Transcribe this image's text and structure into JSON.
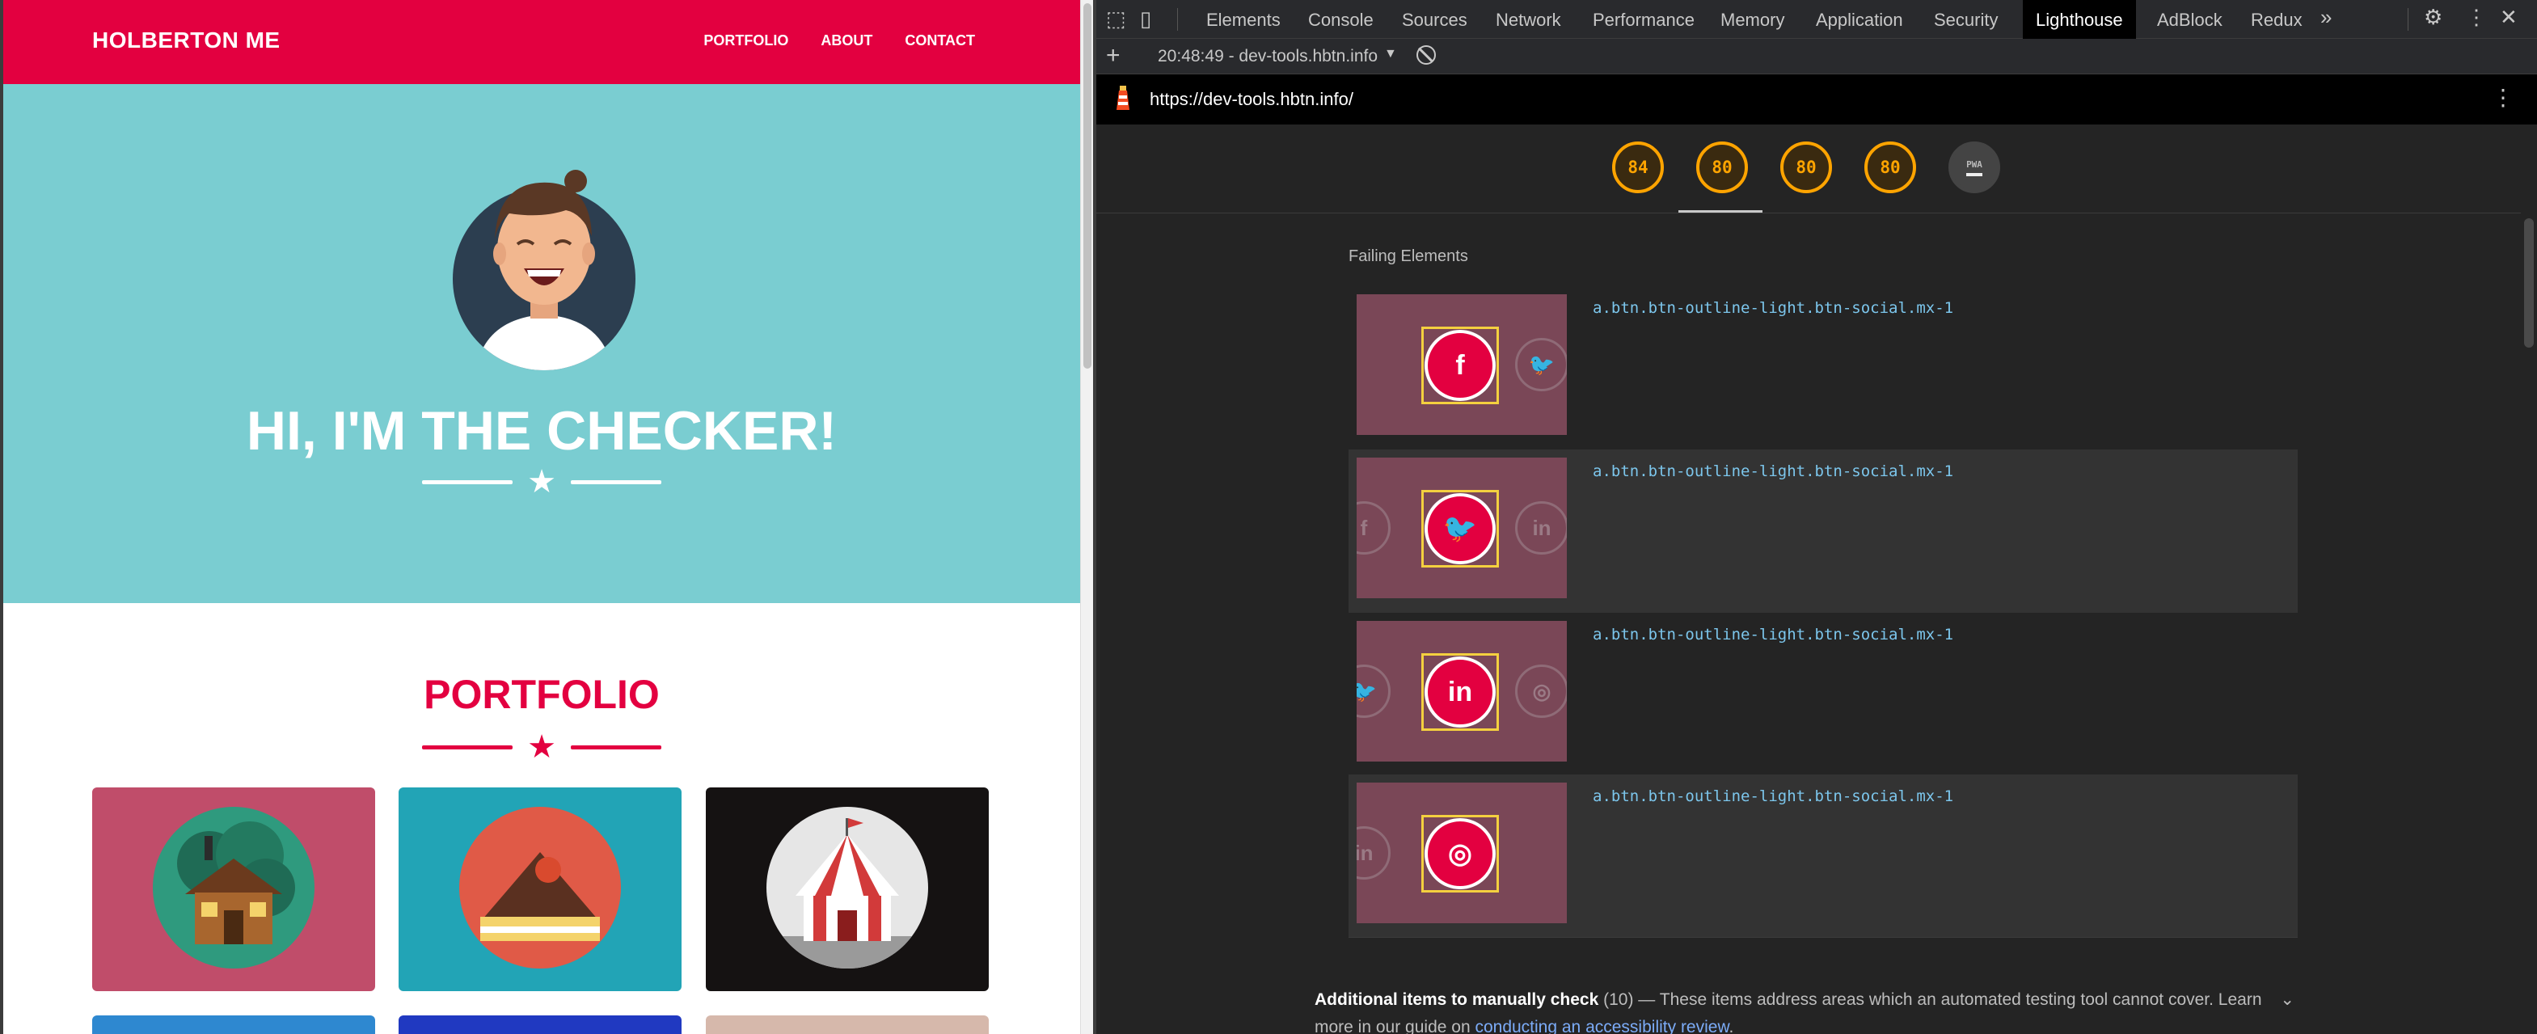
{
  "site": {
    "brand": "HOLBERTON ME",
    "nav": [
      "PORTFOLIO",
      "ABOUT",
      "CONTACT"
    ],
    "hero_title": "HI, I'M THE CHECKER!",
    "portfolio_title": "PORTFOLIO",
    "colors": {
      "primary": "#e30040",
      "hero_bg": "#7acdd1"
    },
    "cards": [
      {
        "icon": "cabin-icon",
        "bg": "#c04d6a"
      },
      {
        "icon": "cake-icon",
        "bg": "#22a4b6"
      },
      {
        "icon": "circus-tent-icon",
        "bg": "#151212"
      },
      {
        "icon": "partial-card",
        "bg": "#2e88d0"
      },
      {
        "icon": "partial-card",
        "bg": "#2039c1"
      },
      {
        "icon": "partial-card",
        "bg": "#d6b8ab"
      }
    ]
  },
  "devtools": {
    "tabs": [
      "Elements",
      "Console",
      "Sources",
      "Network",
      "Performance",
      "Memory",
      "Application",
      "Security",
      "Lighthouse",
      "AdBlock",
      "Redux"
    ],
    "active_tab": "Lighthouse",
    "report_select": "20:48:49 - dev-tools.hbtn.info",
    "url": "https://dev-tools.hbtn.info/",
    "scores": [
      "84",
      "80",
      "80",
      "80"
    ],
    "pwa_label": "PWA",
    "section_label": "Failing Elements",
    "failing": [
      {
        "selector": "a.btn.btn-outline-light.btn-social.mx-1",
        "main_icon": "f",
        "left_icon": "",
        "right_icon": "🐦"
      },
      {
        "selector": "a.btn.btn-outline-light.btn-social.mx-1",
        "main_icon": "🐦",
        "left_icon": "f",
        "right_icon": "in"
      },
      {
        "selector": "a.btn.btn-outline-light.btn-social.mx-1",
        "main_icon": "in",
        "left_icon": "🐦",
        "right_icon": "◎"
      },
      {
        "selector": "a.btn.btn-outline-light.btn-social.mx-1",
        "main_icon": "◎",
        "left_icon": "in",
        "right_icon": ""
      }
    ],
    "manual": {
      "heading": "Additional items to manually check",
      "count": "(10)",
      "text": "— These items address areas which an automated testing tool cannot cover. Learn more in our guide on",
      "link": "conducting an accessibility review",
      "end": "."
    }
  }
}
